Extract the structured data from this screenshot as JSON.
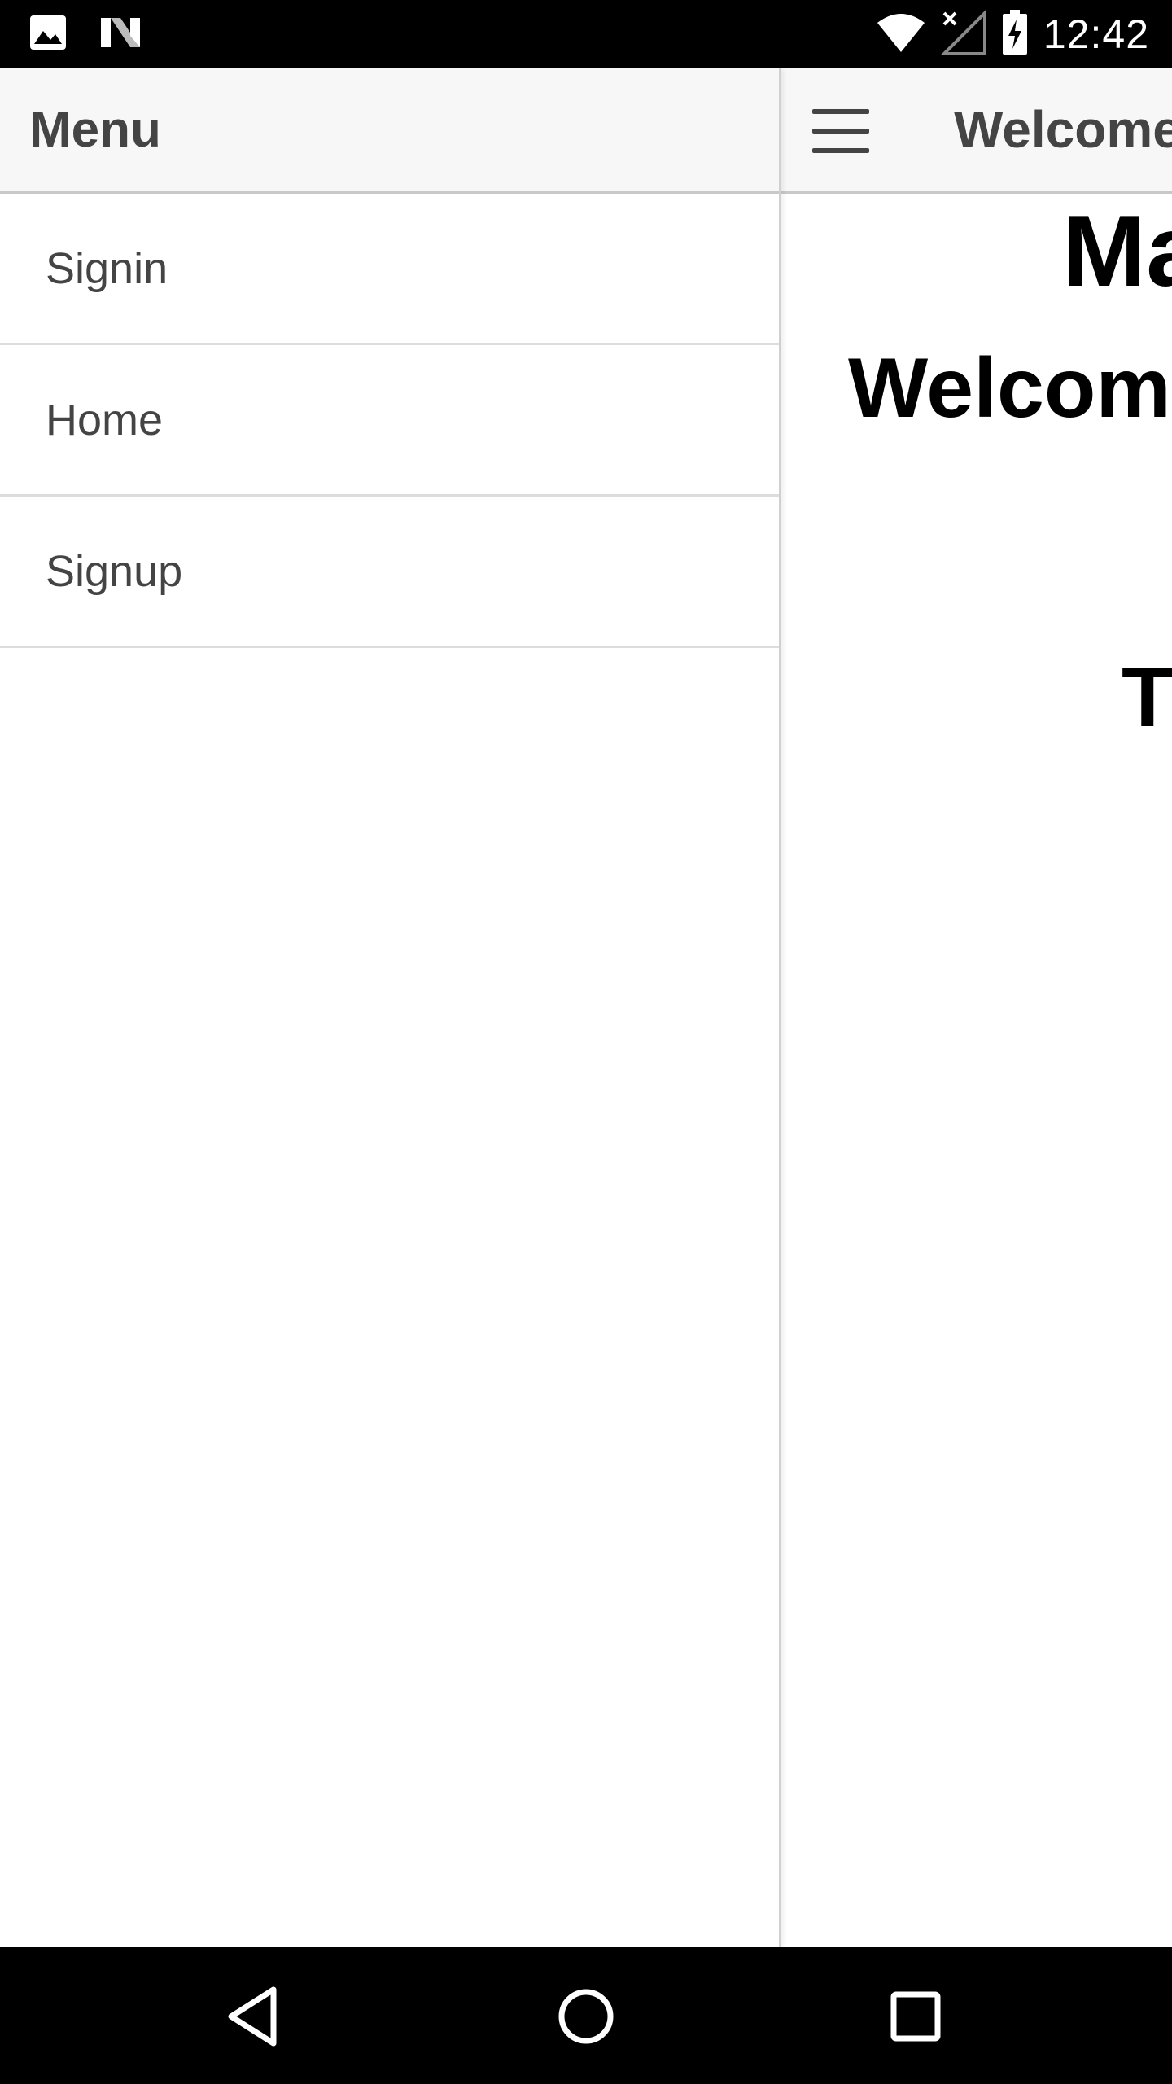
{
  "status_bar": {
    "time": "12:42",
    "icons": [
      "image-icon",
      "n-logo-icon",
      "wifi-icon",
      "no-signal-icon",
      "battery-charging-icon"
    ]
  },
  "drawer": {
    "title": "Menu",
    "items": [
      {
        "label": "Signin"
      },
      {
        "label": "Home"
      },
      {
        "label": "Signup"
      }
    ]
  },
  "toolbar": {
    "title": "Welcome",
    "menu_icon": "hamburger-icon"
  },
  "content": {
    "heading_main": "Ma",
    "heading_welcome": "Welcome",
    "heading_t": "T"
  },
  "nav_bar": {
    "buttons": [
      "back-icon",
      "home-icon",
      "recents-icon"
    ]
  },
  "colors": {
    "header_bg": "#f7f7f7",
    "text": "#444444",
    "divider": "#dcdcdc"
  }
}
